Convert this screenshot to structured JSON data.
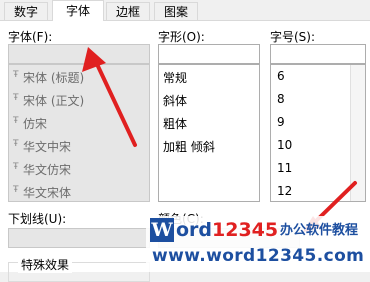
{
  "tabs": [
    "数字",
    "字体",
    "边框",
    "图案"
  ],
  "font": {
    "label": "字体(F):",
    "items": [
      "宋体 (标题)",
      "宋体 (正文)",
      "仿宋",
      "华文中宋",
      "华文仿宋",
      "华文宋体"
    ]
  },
  "style": {
    "label": "字形(O):",
    "items": [
      "常规",
      "斜体",
      "粗体",
      "加粗 倾斜"
    ]
  },
  "size": {
    "label": "字号(S):",
    "items": [
      "6",
      "8",
      "9",
      "10",
      "11",
      "12"
    ]
  },
  "underline": {
    "label": "下划线(U):"
  },
  "color": {
    "label": "颜色(C):"
  },
  "effects": {
    "label": "特殊效果"
  },
  "watermark": {
    "brand_w": "W",
    "brand_ord": "ord",
    "brand_num": "12345",
    "brand_cn": "办公软件教程",
    "url": "www.word12345.com"
  },
  "colors": {
    "accent_red": "#e02020",
    "watermark_blue": "#1d4fa0"
  }
}
